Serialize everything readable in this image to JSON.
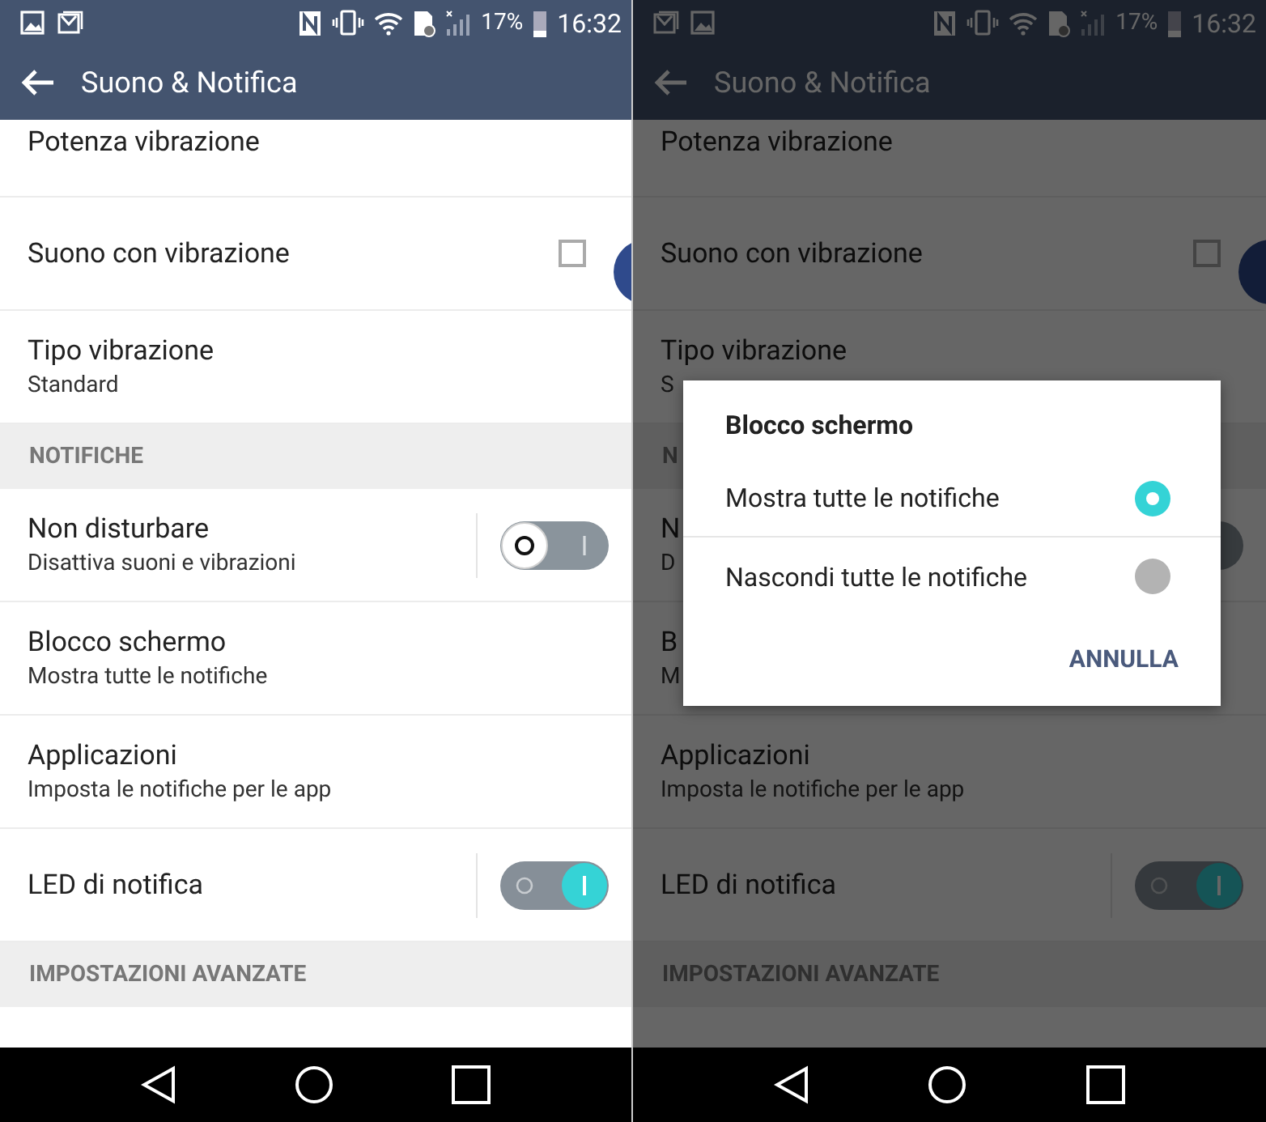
{
  "screens": [
    {
      "notification_icons": [
        {
          "kind": "picture"
        },
        {
          "kind": "mail"
        }
      ],
      "status_bar": {
        "battery": "17%",
        "time": "16:32"
      },
      "app_bar": {
        "title": "Suono & Notifica"
      },
      "rows": [
        {
          "kind": "item",
          "title": "Potenza vibrazione"
        },
        {
          "kind": "checkbox",
          "title": "Suono con vibrazione",
          "checked": false
        },
        {
          "kind": "item",
          "title": "Tipo vibrazione",
          "summary": "Standard"
        },
        {
          "kind": "header",
          "title": "NOTIFICHE"
        },
        {
          "kind": "switch",
          "title": "Non disturbare",
          "summary": "Disattiva suoni e vibrazioni",
          "on": false
        },
        {
          "kind": "item",
          "title": "Blocco schermo",
          "summary": "Mostra tutte le notifiche"
        },
        {
          "kind": "item",
          "title": "Applicazioni",
          "summary": "Imposta le notifiche per le app"
        },
        {
          "kind": "switch",
          "title": "LED di notifica",
          "on": true
        },
        {
          "kind": "header",
          "title": "IMPOSTAZIONI AVANZATE"
        }
      ]
    },
    {
      "notification_icons": [
        {
          "kind": "mail"
        },
        {
          "kind": "picture"
        }
      ],
      "status_bar": {
        "battery": "17%",
        "time": "16:32"
      },
      "app_bar": {
        "title": "Suono & Notifica"
      },
      "rows": [
        {
          "kind": "item",
          "title": "Potenza vibrazione"
        },
        {
          "kind": "checkbox",
          "title": "Suono con vibrazione",
          "checked": false
        },
        {
          "kind": "item",
          "title": "Tipo vibrazione",
          "summary": "S"
        },
        {
          "kind": "header",
          "title": "N"
        },
        {
          "kind": "switch",
          "title": "N",
          "summary": "D",
          "on": false
        },
        {
          "kind": "item",
          "title": "B",
          "summary": "M"
        },
        {
          "kind": "item",
          "title": "Applicazioni",
          "summary": "Imposta le notifiche per le app"
        },
        {
          "kind": "switch",
          "title": "LED di notifica",
          "on": true
        },
        {
          "kind": "header",
          "title": "IMPOSTAZIONI AVANZATE"
        }
      ],
      "dialog": {
        "title": "Blocco schermo",
        "options": [
          {
            "label": "Mostra tutte le notifiche",
            "selected": true
          },
          {
            "label": "Nascondi tutte le notifiche",
            "selected": false
          }
        ],
        "buttons": [
          "ANNULLA"
        ]
      }
    }
  ]
}
